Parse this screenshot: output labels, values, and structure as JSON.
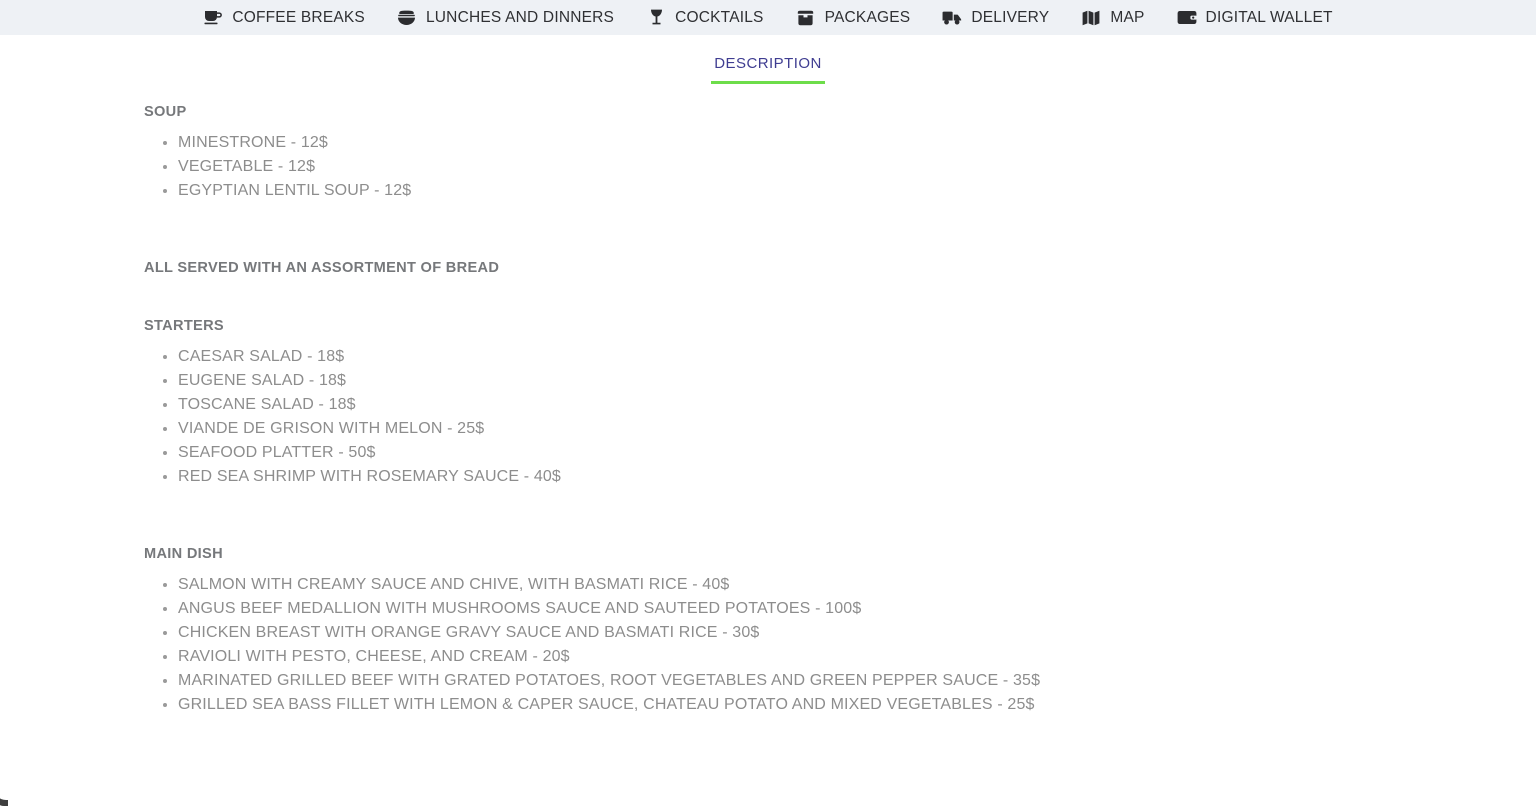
{
  "navbar": {
    "items": [
      {
        "label": "COFFEE BREAKS",
        "icon": "coffee-cup-icon"
      },
      {
        "label": "LUNCHES AND DINNERS",
        "icon": "covered-bowl-icon"
      },
      {
        "label": "COCKTAILS",
        "icon": "cocktail-glass-icon"
      },
      {
        "label": "PACKAGES",
        "icon": "package-box-icon"
      },
      {
        "label": "DELIVERY",
        "icon": "delivery-truck-icon"
      },
      {
        "label": "MAP",
        "icon": "folded-map-icon"
      },
      {
        "label": "DIGITAL WALLET",
        "icon": "wallet-icon"
      }
    ]
  },
  "tabs": {
    "active": "DESCRIPTION"
  },
  "colors": {
    "navbar_background": "#eef1f5",
    "tab_text": "#3f3d91",
    "tab_underline": "#6ddd4a",
    "heading_text": "#76787b",
    "item_text": "#8d8d8d"
  },
  "menu": {
    "soup": {
      "title": "SOUP",
      "items": [
        "MINESTRONE - 12$",
        "VEGETABLE - 12$",
        "EGYPTIAN LENTIL SOUP - 12$"
      ]
    },
    "bread_note": "ALL SERVED WITH AN ASSORTMENT OF BREAD",
    "starters": {
      "title": "STARTERS",
      "items": [
        "CAESAR SALAD - 18$",
        "EUGENE SALAD - 18$",
        "TOSCANE SALAD - 18$",
        "VIANDE DE GRISON WITH MELON - 25$",
        "SEAFOOD PLATTER - 50$",
        "RED SEA SHRIMP WITH ROSEMARY SAUCE - 40$"
      ]
    },
    "main_dish": {
      "title": "MAIN DISH",
      "items": [
        "SALMON WITH CREAMY SAUCE AND CHIVE, WITH BASMATI RICE - 40$",
        "ANGUS BEEF MEDALLION WITH MUSHROOMS SAUCE AND SAUTEED POTATOES - 100$",
        "CHICKEN BREAST WITH ORANGE GRAVY SAUCE AND BASMATI RICE - 30$",
        "RAVIOLI WITH PESTO, CHEESE, AND CREAM - 20$",
        "MARINATED GRILLED BEEF WITH GRATED POTATOES, ROOT VEGETABLES AND GREEN PEPPER SAUCE - 35$",
        "GRILLED SEA BASS FILLET WITH LEMON & CAPER SAUCE, CHATEAU POTATO AND MIXED VEGETABLES - 25$"
      ]
    }
  }
}
